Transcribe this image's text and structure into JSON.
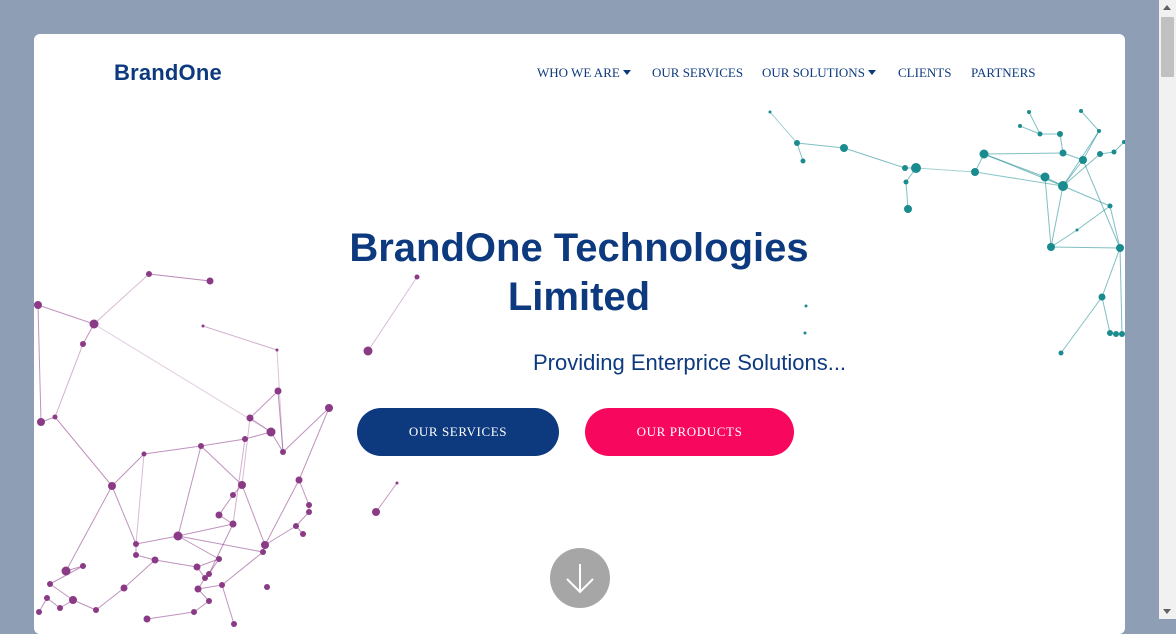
{
  "header": {
    "brand": "BrandOne",
    "nav": [
      {
        "label": "WHO WE ARE",
        "dropdown": true
      },
      {
        "label": "OUR SERVICES",
        "dropdown": false
      },
      {
        "label": "OUR SOLUTIONS",
        "dropdown": true
      },
      {
        "label": "CLIENTS",
        "dropdown": false
      },
      {
        "label": "PARTNERS",
        "dropdown": false
      }
    ]
  },
  "hero": {
    "title_line1": "BrandOne Technologies",
    "title_line2": "Limited",
    "subtitle": "Providing Enterprice Solutions...",
    "primary_button": "OUR SERVICES",
    "secondary_button": "OUR PRODUCTS",
    "scroll_icon": "arrow-down-icon"
  },
  "colors": {
    "page_background": "#8e9fb5",
    "brand_blue": "#0d3a7e",
    "accent_pink": "#f7075d",
    "network_purple": "#8b3a86",
    "network_teal": "#1a8b8f",
    "scroll_button": "#a6a6a6"
  }
}
